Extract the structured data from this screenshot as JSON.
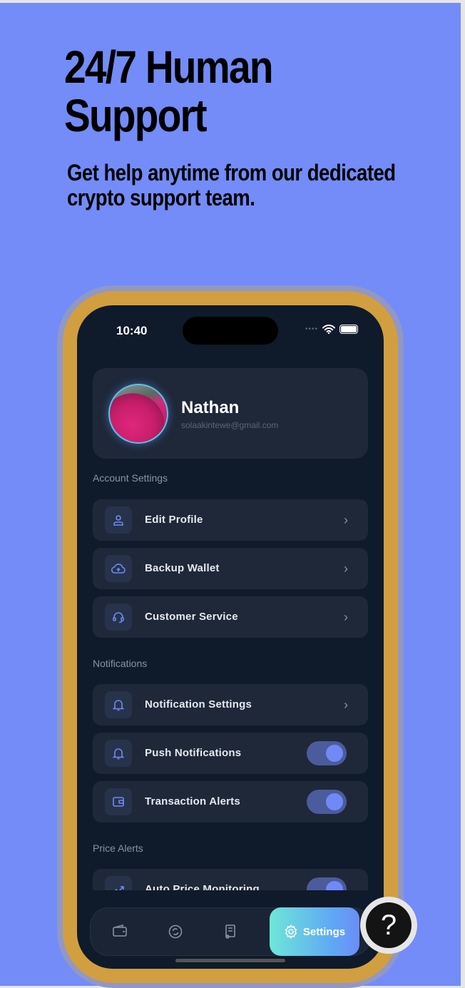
{
  "hero": {
    "title": "24/7 Human Support",
    "subtitle": "Get help anytime from our dedicated crypto support team."
  },
  "status": {
    "time": "10:40"
  },
  "profile": {
    "name": "Nathan",
    "email": "solaakintewe@gmail.com"
  },
  "sections": {
    "account": "Account Settings",
    "notifications": "Notifications",
    "price": "Price Alerts"
  },
  "account_items": [
    {
      "label": "Edit Profile",
      "icon": "user-icon"
    },
    {
      "label": "Backup Wallet",
      "icon": "cloud-upload-icon"
    },
    {
      "label": "Customer Service",
      "icon": "headset-icon"
    }
  ],
  "notification_items": [
    {
      "label": "Notification Settings",
      "icon": "bell-icon"
    },
    {
      "label": "Push Notifications",
      "icon": "bell-icon",
      "toggle": true
    },
    {
      "label": "Transaction Alerts",
      "icon": "wallet-icon",
      "toggle": true
    }
  ],
  "price_items": [
    {
      "label": "Auto Price Monitoring",
      "icon": "trending-up-icon",
      "toggle": true
    }
  ],
  "nav": {
    "active": "Settings",
    "items": [
      "wallet-icon",
      "swap-icon",
      "receipt-icon",
      "settings-icon"
    ]
  },
  "help": {
    "label": "?"
  },
  "colors": {
    "background": "#738cf8",
    "accent": "#7189f7",
    "frame": "#d19f40",
    "screen": "#0f1a2b"
  }
}
